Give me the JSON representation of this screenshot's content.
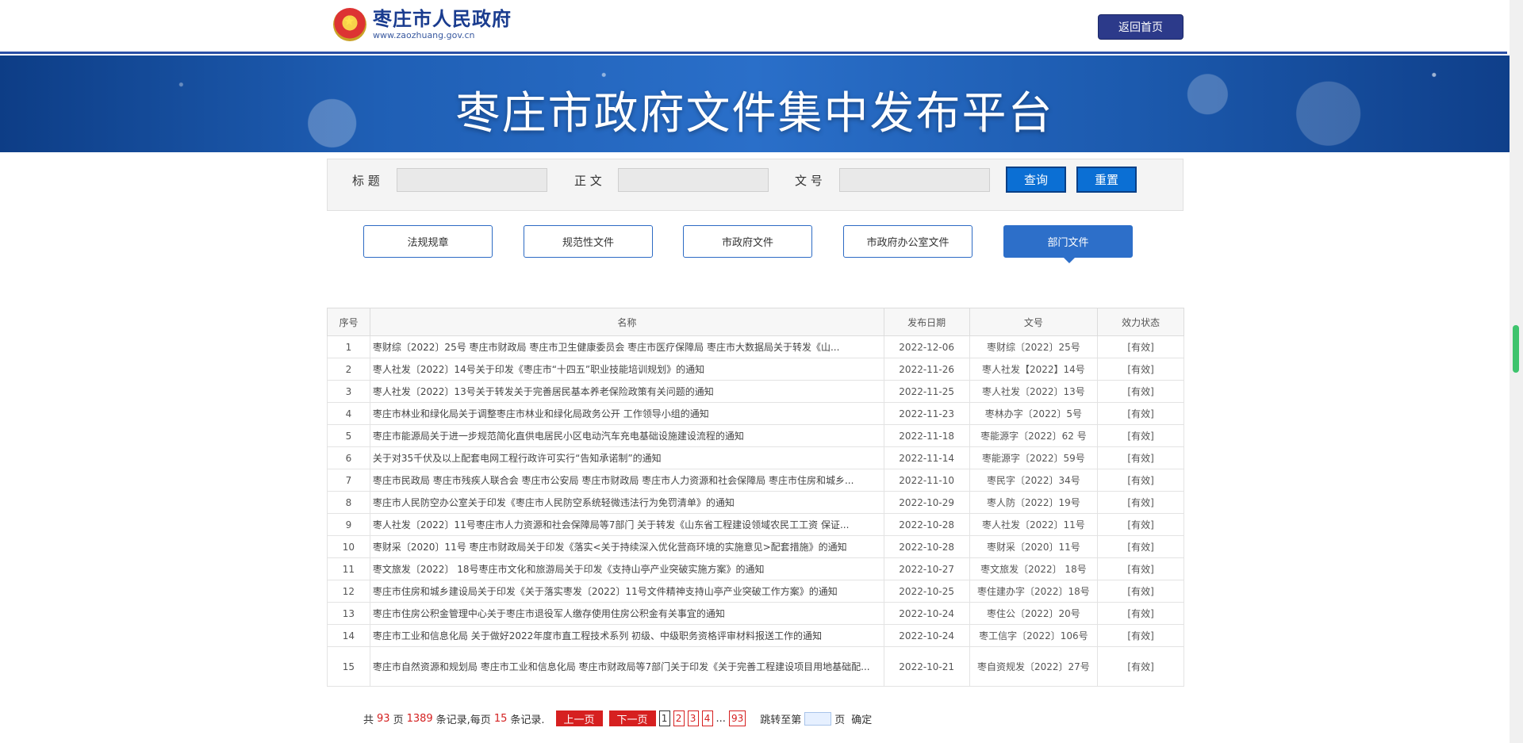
{
  "header": {
    "site_name": "枣庄市人民政府",
    "site_url": "www.zaozhuang.gov.cn",
    "home_button": "返回首页"
  },
  "banner": {
    "title": "枣庄市政府文件集中发布平台"
  },
  "search": {
    "title_label": "标 题",
    "body_label": "正 文",
    "docno_label": "文 号",
    "query_button": "查询",
    "reset_button": "重置"
  },
  "tabs": [
    {
      "label": "法规规章"
    },
    {
      "label": "规范性文件"
    },
    {
      "label": "市政府文件"
    },
    {
      "label": "市政府办公室文件"
    },
    {
      "label": "部门文件"
    }
  ],
  "table": {
    "headers": [
      "序号",
      "名称",
      "发布日期",
      "文号",
      "效力状态"
    ],
    "rows": [
      {
        "no": "1",
        "name": "枣财综〔2022〕25号 枣庄市财政局 枣庄市卫生健康委员会 枣庄市医疗保障局 枣庄市大数据局关于转发《山...",
        "date": "2022-12-06",
        "docno": "枣财综〔2022〕25号",
        "status": "[有效]"
      },
      {
        "no": "2",
        "name": "枣人社发〔2022〕14号关于印发《枣庄市“十四五”职业技能培训规划》的通知",
        "date": "2022-11-26",
        "docno": "枣人社发【2022】14号",
        "status": "[有效]"
      },
      {
        "no": "3",
        "name": "枣人社发〔2022〕13号关于转发关于完善居民基本养老保险政策有关问题的通知",
        "date": "2022-11-25",
        "docno": "枣人社发〔2022〕13号",
        "status": "[有效]"
      },
      {
        "no": "4",
        "name": "枣庄市林业和绿化局关于调整枣庄市林业和绿化局政务公开 工作领导小组的通知",
        "date": "2022-11-23",
        "docno": "枣林办字〔2022〕5号",
        "status": "[有效]"
      },
      {
        "no": "5",
        "name": "枣庄市能源局关于进一步规范简化直供电居民小区电动汽车充电基础设施建设流程的通知",
        "date": "2022-11-18",
        "docno": "枣能源字〔2022〕62 号",
        "status": "[有效]"
      },
      {
        "no": "6",
        "name": "关于对35千伏及以上配套电网工程行政许可实行“告知承诺制”的通知",
        "date": "2022-11-14",
        "docno": "枣能源字〔2022〕59号",
        "status": "[有效]"
      },
      {
        "no": "7",
        "name": "枣庄市民政局 枣庄市残疾人联合会 枣庄市公安局 枣庄市财政局 枣庄市人力资源和社会保障局 枣庄市住房和城乡...",
        "date": "2022-11-10",
        "docno": "枣民字〔2022〕34号",
        "status": "[有效]"
      },
      {
        "no": "8",
        "name": "枣庄市人民防空办公室关于印发《枣庄市人民防空系统轻微违法行为免罚清单》的通知",
        "date": "2022-10-29",
        "docno": "枣人防〔2022〕19号",
        "status": "[有效]"
      },
      {
        "no": "9",
        "name": "枣人社发〔2022〕11号枣庄市人力资源和社会保障局等7部门 关于转发《山东省工程建设领域农民工工资 保证...",
        "date": "2022-10-28",
        "docno": "枣人社发〔2022〕11号",
        "status": "[有效]"
      },
      {
        "no": "10",
        "name": "枣财采〔2020〕11号 枣庄市财政局关于印发《落实<关于持续深入优化营商环境的实施意见>配套措施》的通知",
        "date": "2022-10-28",
        "docno": "枣财采〔2020〕11号",
        "status": "[有效]"
      },
      {
        "no": "11",
        "name": "枣文旅发〔2022〕 18号枣庄市文化和旅游局关于印发《支持山亭产业突破实施方案》的通知",
        "date": "2022-10-27",
        "docno": "枣文旅发〔2022〕 18号",
        "status": "[有效]"
      },
      {
        "no": "12",
        "name": "枣庄市住房和城乡建设局关于印发《关于落实枣发〔2022〕11号文件精神支持山亭产业突破工作方案》的通知",
        "date": "2022-10-25",
        "docno": "枣住建办字〔2022〕18号",
        "status": "[有效]"
      },
      {
        "no": "13",
        "name": "枣庄市住房公积金管理中心关于枣庄市退役军人缴存使用住房公积金有关事宜的通知",
        "date": "2022-10-24",
        "docno": "枣住公〔2022〕20号",
        "status": "[有效]"
      },
      {
        "no": "14",
        "name": "枣庄市工业和信息化局 关于做好2022年度市直工程技术系列 初级、中级职务资格评审材料报送工作的通知",
        "date": "2022-10-24",
        "docno": "枣工信字〔2022〕106号",
        "status": "[有效]"
      },
      {
        "no": "15",
        "name": "枣庄市自然资源和规划局 枣庄市工业和信息化局 枣庄市财政局等7部门关于印发《关于完善工程建设项目用地基础配...",
        "date": "2022-10-21",
        "docno": "枣自资规发〔2022〕27号",
        "status": "[有效]"
      }
    ]
  },
  "pager": {
    "total_prefix": "共",
    "total_pages": "93",
    "pages_text": "页",
    "total_records": "1389",
    "records_text": "条记录,每页",
    "per_page": "15",
    "per_page_text": "条记录.",
    "prev": "上一页",
    "next": "下一页",
    "pages": [
      "1",
      "2",
      "3",
      "4"
    ],
    "ellipsis": "...",
    "last": "93",
    "jump_label": "跳转至第",
    "jump_suffix": "页",
    "confirm": "确定"
  }
}
